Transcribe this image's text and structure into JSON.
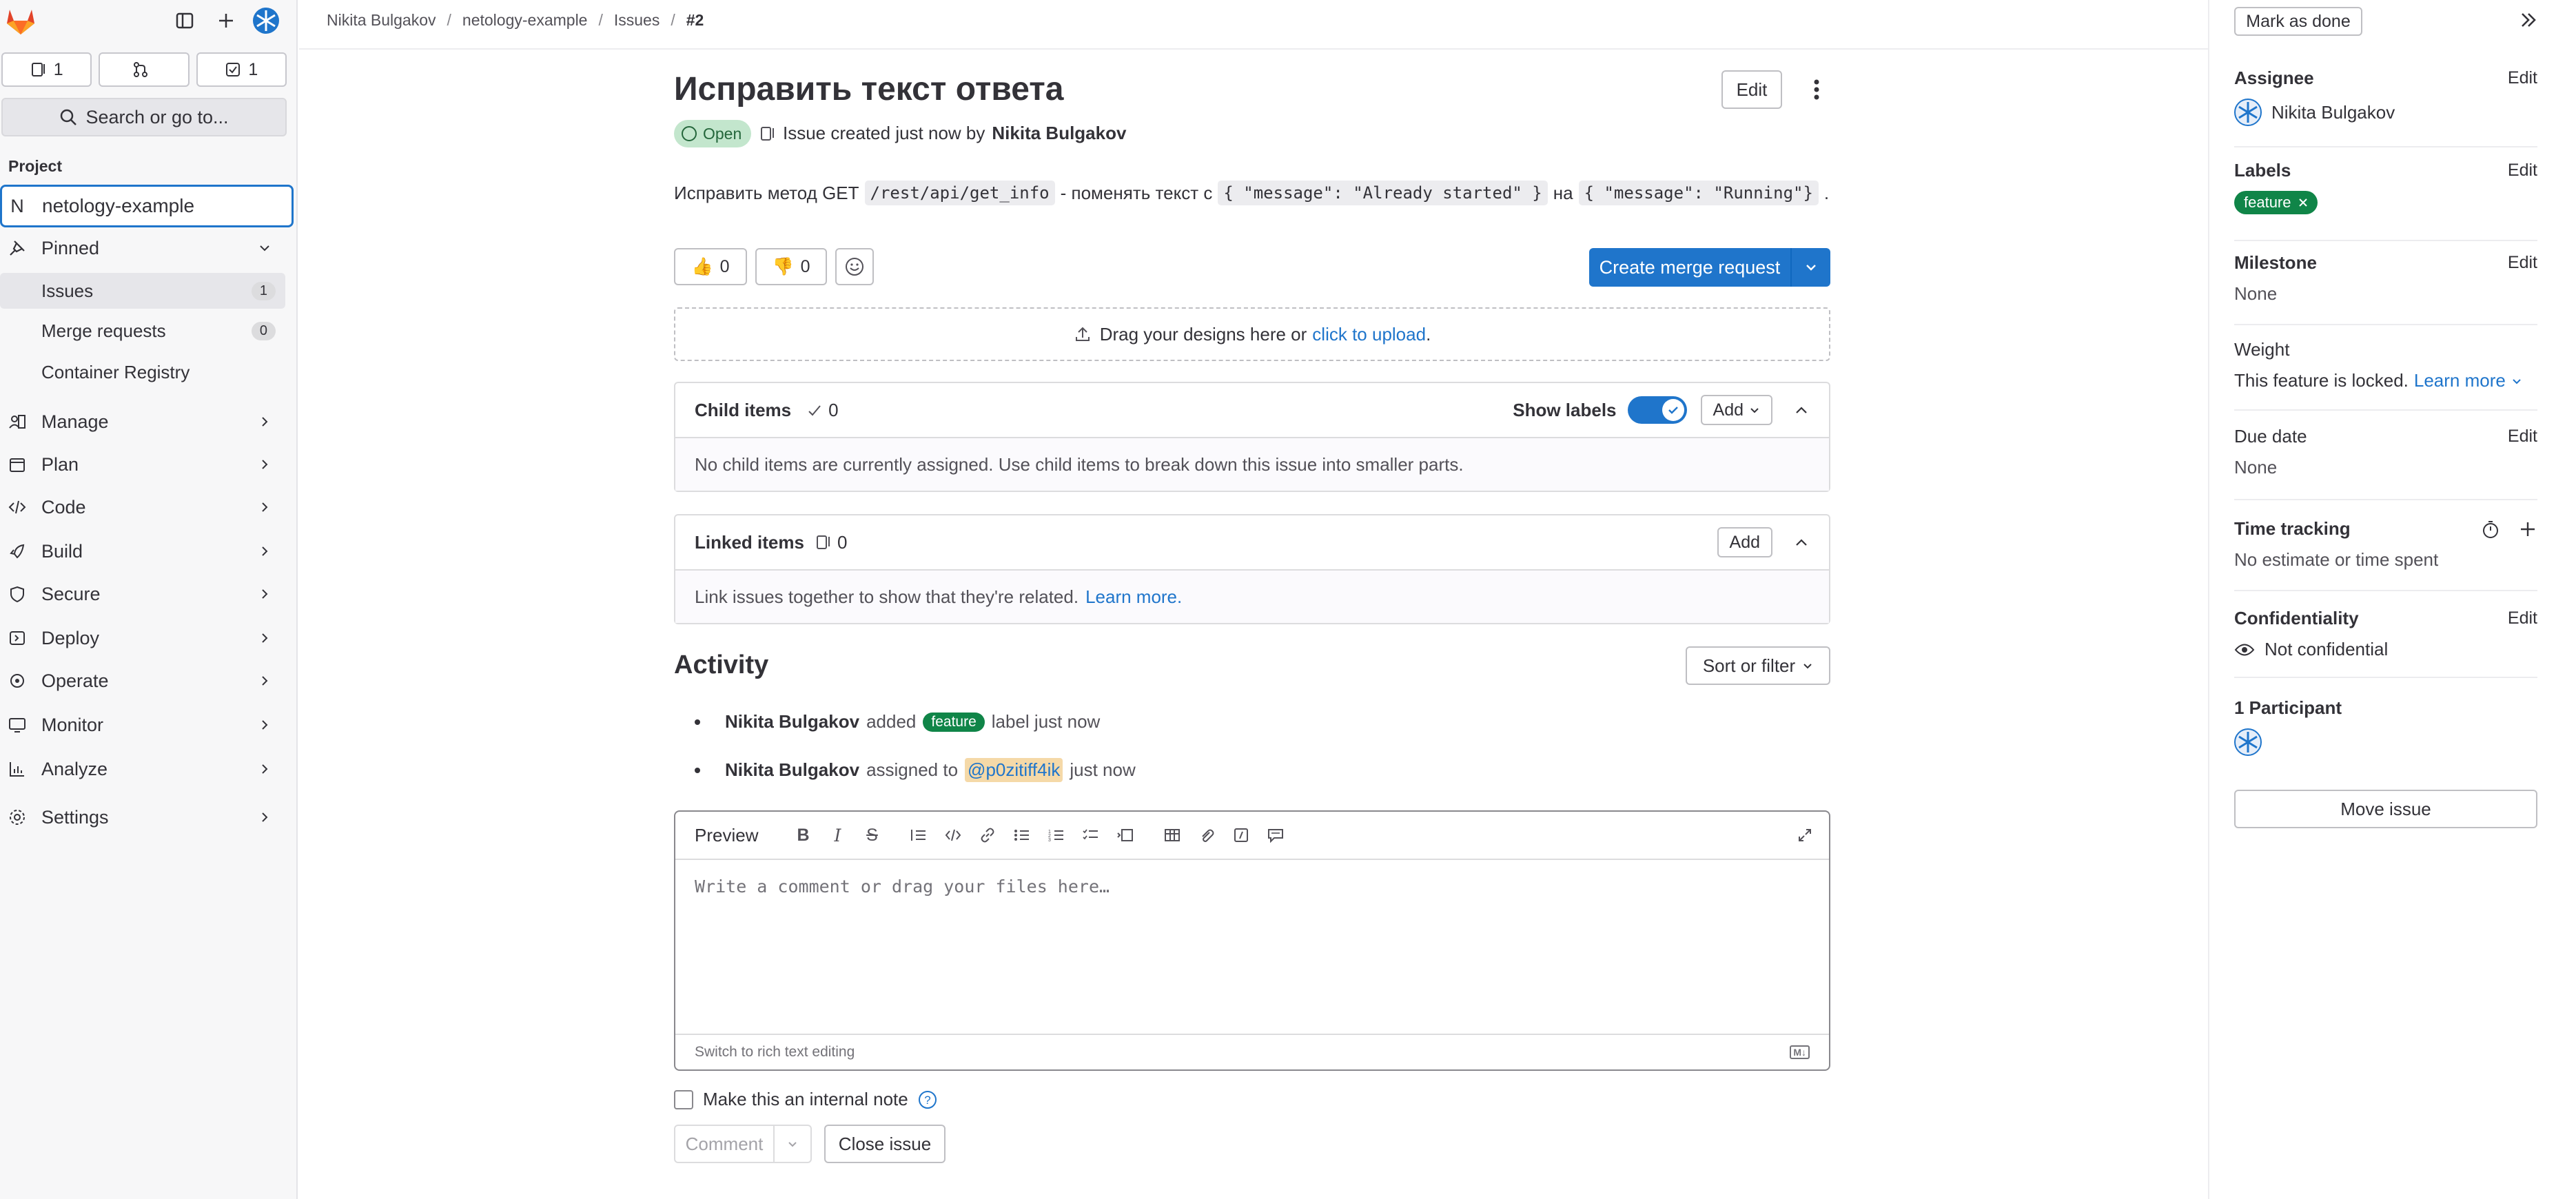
{
  "colors": {
    "accent": "#1f75cb",
    "label_feature": "#108548",
    "open_badge_bg": "#c3e6cd",
    "open_badge_fg": "#24663b",
    "gitlab_orange": "#e24329"
  },
  "sidebar": {
    "counters": [
      "1",
      "",
      "1"
    ],
    "search_label": "Search or go to...",
    "section_label": "Project",
    "project": {
      "initial": "N",
      "name": "netology-example"
    },
    "pinned_label": "Pinned",
    "pinned_items": [
      {
        "label": "Issues",
        "badge": "1"
      },
      {
        "label": "Merge requests",
        "badge": "0"
      },
      {
        "label": "Container Registry",
        "badge": ""
      }
    ],
    "menu": [
      {
        "label": "Manage",
        "icon": "users-icon"
      },
      {
        "label": "Plan",
        "icon": "plan-icon"
      },
      {
        "label": "Code",
        "icon": "code-icon"
      },
      {
        "label": "Build",
        "icon": "rocket-icon"
      },
      {
        "label": "Secure",
        "icon": "shield-icon"
      },
      {
        "label": "Deploy",
        "icon": "deploy-icon"
      },
      {
        "label": "Operate",
        "icon": "cloud-gear-icon"
      },
      {
        "label": "Monitor",
        "icon": "monitor-icon"
      },
      {
        "label": "Analyze",
        "icon": "chart-icon"
      },
      {
        "label": "Settings",
        "icon": "gear-icon"
      }
    ]
  },
  "breadcrumb": [
    "Nikita Bulgakov",
    "netology-example",
    "Issues",
    "#2"
  ],
  "issue": {
    "title": "Исправить текст ответа",
    "edit_label": "Edit",
    "status": "Open",
    "meta_prefix": "Issue created just now by",
    "author": "Nikita Bulgakov",
    "desc": {
      "part1": "Исправить метод GET",
      "code1": "/rest/api/get_info",
      "part2": "- поменять текст с",
      "code2": "{ \"message\": \"Already started\" }",
      "part3": "на",
      "code3": "{ \"message\": \"Running\"}",
      "part4": "."
    },
    "thumbs_up": "0",
    "thumbs_down": "0",
    "create_mr": "Create merge request",
    "dropzone_text": "Drag your designs here or",
    "dropzone_link": "click to upload",
    "dropzone_end": "."
  },
  "child_items": {
    "title": "Child items",
    "count": "0",
    "show_labels": "Show labels",
    "add": "Add",
    "empty": "No child items are currently assigned. Use child items to break down this issue into smaller parts."
  },
  "linked_items": {
    "title": "Linked items",
    "count": "0",
    "add": "Add",
    "empty": "Link issues together to show that they're related.",
    "learn_more": "Learn more."
  },
  "activity": {
    "title": "Activity",
    "sort_label": "Sort or filter",
    "items": [
      {
        "user": "Nikita Bulgakov",
        "action": "added",
        "label": "feature",
        "rest": "label just now"
      },
      {
        "user": "Nikita Bulgakov",
        "action": "assigned to",
        "mention": "@p0zitiff4ik",
        "rest": "just now"
      }
    ]
  },
  "editor": {
    "preview": "Preview",
    "placeholder": "Write a comment or drag your files here…",
    "switch_label": "Switch to rich text editing",
    "md_badge": "M↓",
    "internal_note": "Make this an internal note",
    "comment": "Comment",
    "close_issue": "Close issue"
  },
  "right_sidebar": {
    "mark_done": "Mark as done",
    "assignee": {
      "title": "Assignee",
      "edit": "Edit",
      "value": "Nikita Bulgakov"
    },
    "labels": {
      "title": "Labels",
      "edit": "Edit",
      "value": "feature"
    },
    "milestone": {
      "title": "Milestone",
      "edit": "Edit",
      "value": "None"
    },
    "weight": {
      "title": "Weight",
      "value": "This feature is locked.",
      "link": "Learn more"
    },
    "due_date": {
      "title": "Due date",
      "edit": "Edit",
      "value": "None"
    },
    "time_tracking": {
      "title": "Time tracking",
      "value": "No estimate or time spent"
    },
    "confidentiality": {
      "title": "Confidentiality",
      "edit": "Edit",
      "value": "Not confidential"
    },
    "participants": {
      "title": "1 Participant"
    },
    "move_issue": "Move issue"
  }
}
